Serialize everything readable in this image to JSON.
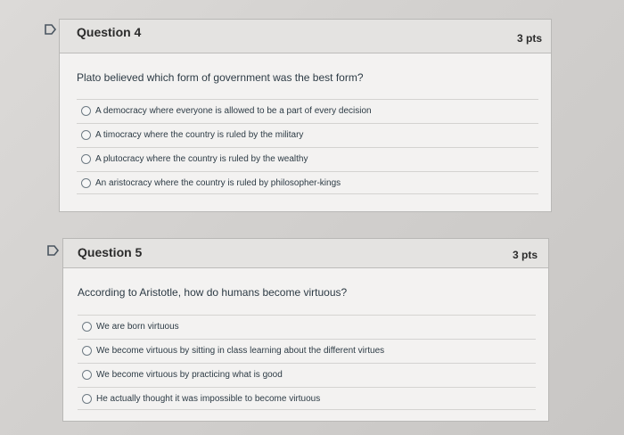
{
  "questions": [
    {
      "title": "Question 4",
      "points": "3 pts",
      "text": "Plato believed which form of government was the best form?",
      "options": [
        "A democracy where everyone is allowed to be a part of every decision",
        "A timocracy where the country is ruled by the military",
        "A plutocracy where the country is ruled by the wealthy",
        "An aristocracy where the country is ruled by philosopher-kings"
      ]
    },
    {
      "title": "Question 5",
      "points": "3 pts",
      "text": "According to Aristotle, how do humans become virtuous?",
      "options": [
        "We are born virtuous",
        "We become virtuous by sitting in class learning about the different virtues",
        "We become virtuous by practicing what is good",
        "He actually thought it was impossible to become virtuous"
      ]
    }
  ],
  "icons": {
    "flag": "flag-icon"
  },
  "colors": {
    "card_bg": "#f3f2f1",
    "header_bg": "#e4e3e1",
    "text": "#2d3b45"
  }
}
